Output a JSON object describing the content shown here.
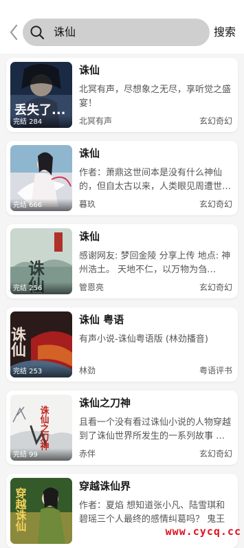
{
  "search": {
    "query": "诛仙",
    "button_label": "搜索"
  },
  "books": [
    {
      "title": "诛仙",
      "desc": "北冥有声，尽想象之无尽，享听觉之盛宴！",
      "author": "北冥有声",
      "genre": "玄幻奇幻",
      "status": "完结 284",
      "cover_colors": [
        "#1b2a44",
        "#3b4f6e"
      ],
      "cover_text": "丢失了...",
      "cover_text_color": "#ffffff"
    },
    {
      "title": "诛仙",
      "desc": "作者：萧鼎这世间本是没有什么神仙的，但自太古以来，人类眼见周遭世…",
      "author": "暮玖",
      "genre": "玄幻奇幻",
      "status": "完结 666",
      "cover_colors": [
        "#8fb6cf",
        "#e8e3e6"
      ],
      "cover_text": "",
      "cover_text_color": "#ffffff"
    },
    {
      "title": "诛仙",
      "desc": "感谢网友: 梦回金陵 分享上传     地点: 神州浩土。   天地不仁，以万物为刍…",
      "author": "管恩亮",
      "genre": "玄幻奇幻",
      "status": "完结 256",
      "cover_colors": [
        "#c9d7cf",
        "#5c7a70"
      ],
      "cover_text": "诛仙",
      "cover_text_color": "#2f3d3a"
    },
    {
      "title": "诛仙 粤语",
      "desc": "有声小说-诛仙粤语版 (林劲播音)",
      "author": "林劲",
      "genre": "粤语评书",
      "status": "完结 253",
      "cover_colors": [
        "#2a1a1a",
        "#b51f1f"
      ],
      "cover_text": "诛仙",
      "cover_text_color": "#e6ddd0"
    },
    {
      "title": "诛仙之刀神",
      "desc": "且看一个没有看过诛仙小说的人物穿越到了诛仙世界所发生的一系列故事  …",
      "author": "赤伴",
      "genre": "玄幻奇幻",
      "status": "完结 99",
      "cover_colors": [
        "#f2f2f0",
        "#c7ccd0"
      ],
      "cover_text": "诛仙之刀神",
      "cover_text_color": "#c0241e"
    },
    {
      "title": "穿越诛仙界",
      "desc": "作者：夏焰 想知道张小凡、陆雪琪和碧瑶三个人最终的感情纠葛吗？ 鬼王宗…",
      "author": "",
      "genre": "",
      "status": "",
      "cover_colors": [
        "#355a2a",
        "#d2b34a"
      ],
      "cover_text": "穿越诛仙",
      "cover_text_color": "#f3d25a"
    }
  ],
  "watermark": "www.cycq.cc",
  "colors": {
    "background": "#f5f5f5",
    "search_box": "#cfcfcf",
    "watermark": "#e0101e"
  }
}
